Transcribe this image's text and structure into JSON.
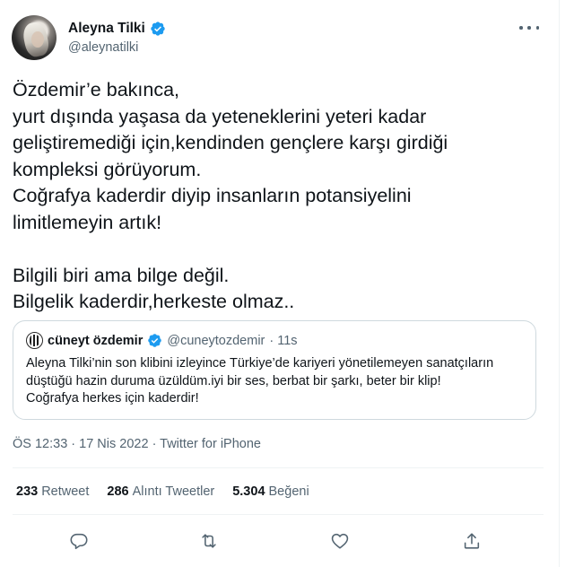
{
  "user": {
    "display_name": "Aleyna Tilki",
    "handle": "@aleynatilki",
    "verified": true
  },
  "tweet": {
    "lines": [
      "Özdemir’e bakınca,",
      "yurt dışında yaşasa da yeteneklerini yeteri kadar",
      "geliştiremediği için,kendinden gençlere karşı girdiği",
      "kompleksi görüyorum.",
      "Coğrafya kaderdir diyip insanların potansiyelini",
      "limitlemeyin artık!",
      "",
      "Bilgili biri ama bilge değil.",
      "Bilgelik kaderdir,herkeste olmaz.."
    ]
  },
  "quote": {
    "display_name": "cüneyt özdemir",
    "handle": "@cuneytozdemir",
    "time": "· 11s",
    "lines": [
      "Aleyna Tilki’nin son klibini izleyince Türkiye’de kariyeri yönetilemeyen sanatçıların",
      "düştüğü hazin duruma üzüldüm.iyi bir ses, berbat bir şarkı, beter bir klip!",
      "Coğrafya herkes için kaderdir!"
    ]
  },
  "meta": {
    "timestamp": "ÖS 12:33 · 17 Nis 2022 · Twitter for iPhone"
  },
  "stats": {
    "retweets": {
      "count": "233",
      "label": "Retweet"
    },
    "quotes": {
      "count": "286",
      "label": "Alıntı Tweetler"
    },
    "likes": {
      "count": "5.304",
      "label": "Beğeni"
    }
  },
  "actions": {
    "reply_icon": "reply-icon",
    "retweet_icon": "retweet-icon",
    "like_icon": "like-icon",
    "share_icon": "share-icon"
  },
  "colors": {
    "text": "#0f1419",
    "secondary": "#536471",
    "verified": "#1d9bf0",
    "border": "#cfd9de"
  }
}
